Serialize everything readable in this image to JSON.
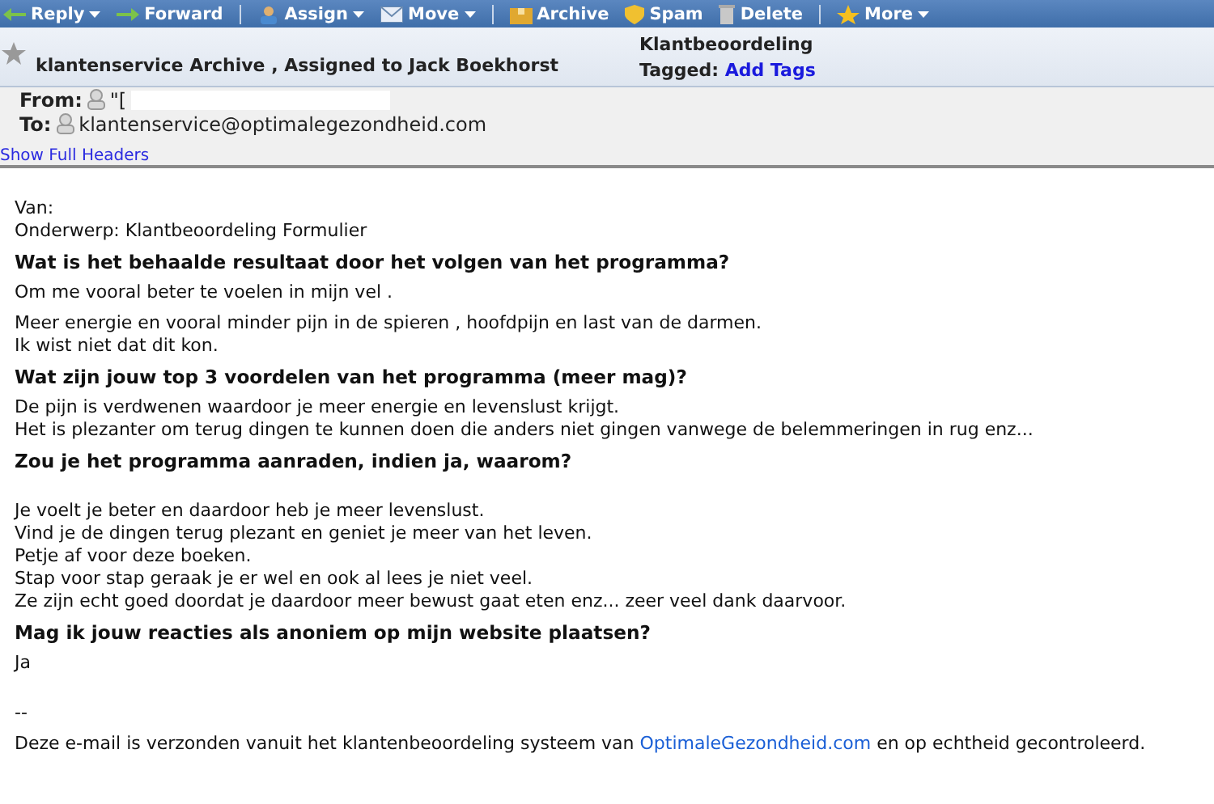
{
  "toolbar": [
    [
      {
        "label": "Reply",
        "kind": "reply",
        "caret": true
      },
      {
        "label": "Forward",
        "kind": "forward",
        "caret": false
      }
    ],
    [
      {
        "label": "Assign",
        "kind": "assign",
        "caret": true
      },
      {
        "label": "Move",
        "kind": "move",
        "caret": true
      }
    ],
    [
      {
        "label": "Archive",
        "kind": "archive",
        "caret": false
      },
      {
        "label": "Spam",
        "kind": "spam",
        "caret": false
      },
      {
        "label": "Delete",
        "kind": "delete",
        "caret": false
      }
    ],
    [
      {
        "label": "More",
        "kind": "more",
        "caret": true
      }
    ]
  ],
  "message_header": {
    "starred": false,
    "folder_line": "klantenservice Archive , Assigned to Jack Boekhorst",
    "subject": "Klantbeoordeling",
    "tagged_label": "Tagged:",
    "add_tags": "Add Tags",
    "from_label": "From:",
    "from_value": "\"[",
    "to_label": "To:",
    "to_value": "klantenservice@optimalegezondheid.com",
    "show_full_headers": "Show Full Headers"
  },
  "body": [
    {
      "kind": "gap"
    },
    {
      "kind": "line",
      "text": "Van:"
    },
    {
      "kind": "line",
      "text": "Onderwerp: Klantbeoordeling Formulier"
    },
    {
      "kind": "question",
      "text": "Wat is het behaalde resultaat door het volgen van het programma?"
    },
    {
      "kind": "para",
      "lines": [
        "Om me vooral beter te voelen in mijn vel ."
      ]
    },
    {
      "kind": "para",
      "lines": [
        "Meer energie en vooral minder pijn in de spieren , hoofdpijn en last van de darmen.",
        "Ik wist niet dat dit kon."
      ]
    },
    {
      "kind": "question",
      "text": "Wat zijn jouw top 3 voordelen van het programma (meer mag)?"
    },
    {
      "kind": "para",
      "lines": [
        "De pijn is verdwenen waardoor je meer energie en levenslust krijgt.",
        "Het is plezanter om terug dingen te kunnen doen die anders niet gingen vanwege de belemmeringen in rug enz..."
      ]
    },
    {
      "kind": "question",
      "text": "Zou je het programma aanraden, indien ja, waarom?"
    },
    {
      "kind": "gap"
    },
    {
      "kind": "para",
      "lines": [
        "Je voelt je beter en daardoor heb je meer levenslust.",
        "Vind je de dingen terug plezant en geniet je meer van het leven.",
        "Petje af voor deze boeken.",
        "Stap voor stap geraak je er wel en ook al lees je niet veel.",
        "Ze zijn echt goed doordat je daardoor meer bewust gaat eten enz... zeer veel dank daarvoor."
      ]
    },
    {
      "kind": "question",
      "text": "Mag ik jouw reacties als anoniem op mijn website plaatsen?"
    },
    {
      "kind": "para",
      "lines": [
        "Ja"
      ]
    },
    {
      "kind": "gap"
    },
    {
      "kind": "para",
      "lines": [
        "--"
      ]
    },
    {
      "kind": "footer",
      "before": "Deze e-mail is verzonden vanuit het klantenbeoordeling systeem van ",
      "link": "OptimaleGezondheid.com",
      "after": " en op echtheid gecontroleerd."
    }
  ]
}
